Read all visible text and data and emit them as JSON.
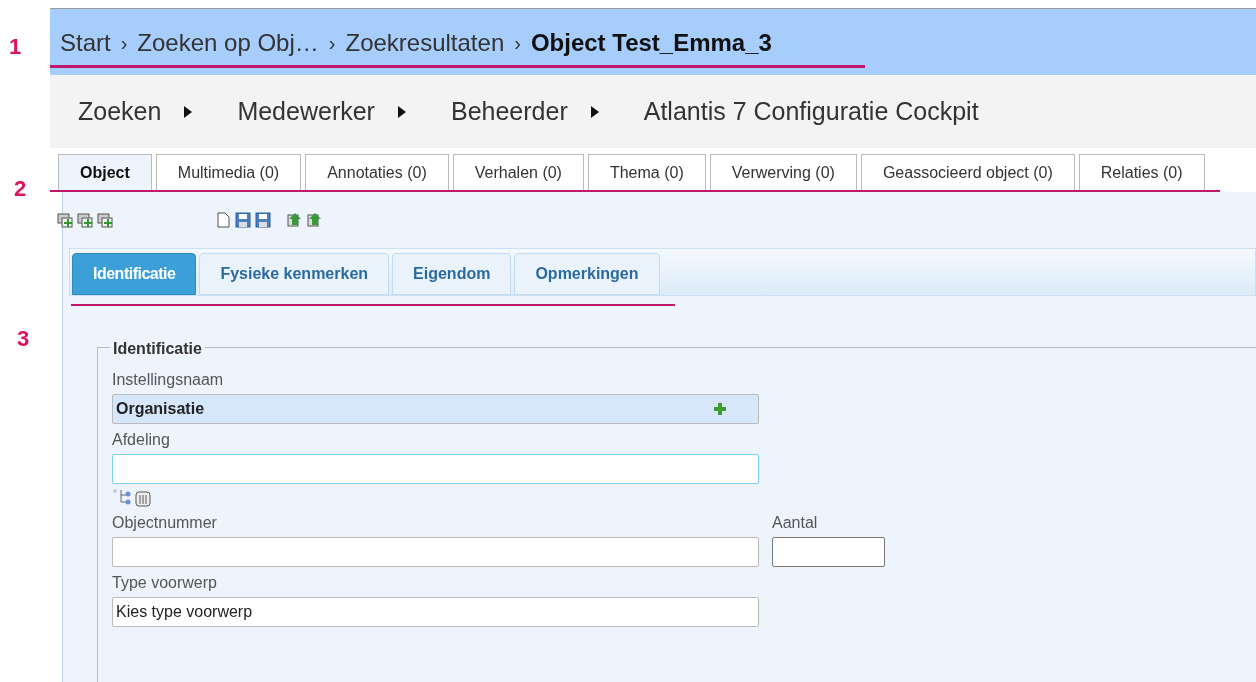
{
  "annotations": [
    "1",
    "2",
    "3"
  ],
  "breadcrumb": [
    {
      "label": "Start",
      "current": false
    },
    {
      "label": "Zoeken op Obj…",
      "current": false
    },
    {
      "label": "Zoekresultaten",
      "current": false
    },
    {
      "label": "Object Test_Emma_3",
      "current": true
    }
  ],
  "breadcrumb_separator": "›",
  "menu": [
    {
      "label": "Zoeken",
      "submenu": true
    },
    {
      "label": "Medewerker",
      "submenu": true
    },
    {
      "label": "Beheerder",
      "submenu": true
    },
    {
      "label": "Atlantis 7 Configuratie Cockpit",
      "submenu": false
    }
  ],
  "tabs": [
    {
      "label": "Object",
      "selected": true
    },
    {
      "label": "Multimedia (0)",
      "selected": false
    },
    {
      "label": "Annotaties (0)",
      "selected": false
    },
    {
      "label": "Verhalen (0)",
      "selected": false
    },
    {
      "label": "Thema (0)",
      "selected": false
    },
    {
      "label": "Verwerving (0)",
      "selected": false
    },
    {
      "label": "Geassocieerd object (0)",
      "selected": false
    },
    {
      "label": "Relaties (0)",
      "selected": false
    }
  ],
  "subtabs": [
    {
      "label": "Identificatie",
      "selected": true
    },
    {
      "label": "Fysieke kenmerken",
      "selected": false
    },
    {
      "label": "Eigendom",
      "selected": false
    },
    {
      "label": "Opmerkingen",
      "selected": false
    }
  ],
  "fieldset": {
    "legend": "Identificatie",
    "rows": [
      [
        {
          "label": "Instellingsnaam",
          "value": "Organisatie",
          "kind": "lookup",
          "focused": false
        }
      ],
      [
        {
          "label": "Afdeling",
          "kind": "text",
          "focused": true,
          "tools": true
        }
      ],
      [
        {
          "label": "Objectnummer",
          "kind": "text",
          "focused": false
        },
        {
          "label": "Aantal",
          "kind": "small",
          "focused": false
        }
      ],
      [
        {
          "label": "Type voorwerp",
          "value": "Kies type voorwerp",
          "kind": "text",
          "focused": false
        }
      ]
    ]
  }
}
